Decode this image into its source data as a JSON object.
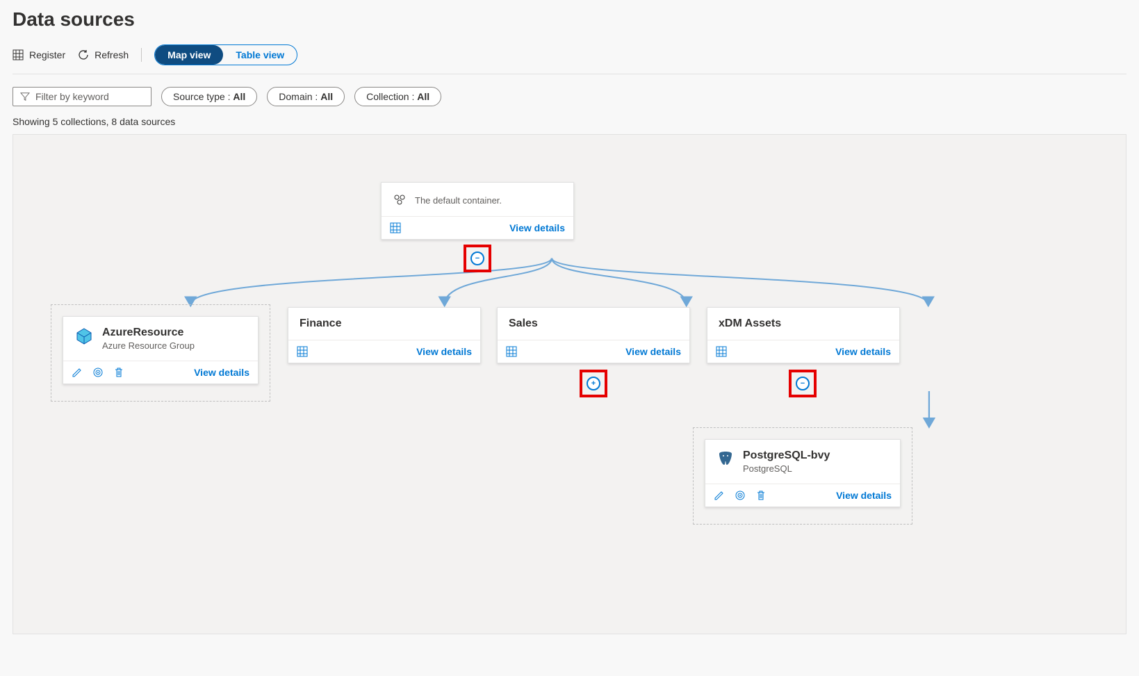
{
  "page": {
    "title": "Data sources"
  },
  "toolbar": {
    "register": "Register",
    "refresh": "Refresh",
    "view_map": "Map view",
    "view_table": "Table view"
  },
  "filters": {
    "keyword_placeholder": "Filter by keyword",
    "source_type_label": "Source type : ",
    "source_type_value": "All",
    "domain_label": "Domain : ",
    "domain_value": "All",
    "collection_label": "Collection : ",
    "collection_value": "All"
  },
  "status": "Showing 5 collections, 8 data sources",
  "labels": {
    "view_details": "View details"
  },
  "nodes": {
    "root": {
      "subtitle": "The default container."
    },
    "azure": {
      "title": "AzureResource",
      "subtitle": "Azure Resource Group"
    },
    "finance": {
      "title": "Finance"
    },
    "sales": {
      "title": "Sales"
    },
    "xdm": {
      "title": "xDM Assets"
    },
    "pg": {
      "title": "PostgreSQL-bvy",
      "subtitle": "PostgreSQL"
    }
  },
  "expand": {
    "minus": "−",
    "plus": "+"
  }
}
